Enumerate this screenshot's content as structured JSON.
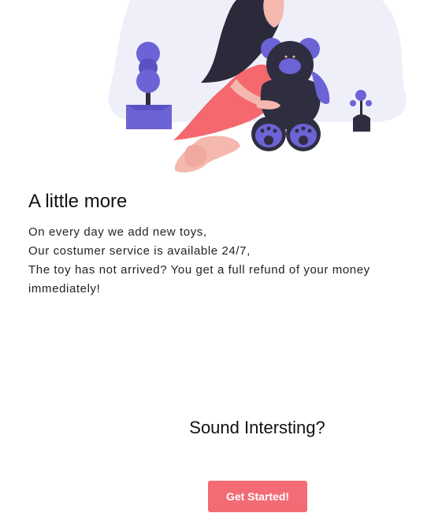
{
  "hero": {
    "image_icon": "girl-with-teddy-bear-illustration",
    "colors": {
      "background_blob": "#efeffa",
      "accent_purple": "#6c63d6",
      "dress": "#f4686e",
      "skin": "#f5b8ae",
      "hair": "#2b2a3a",
      "bear": "#2f2e41"
    }
  },
  "content": {
    "title": "A little more",
    "lines": [
      "On every day we add new toys,",
      "Our costumer service is available 24/7,",
      "The toy has not arrived? You get a full refund of your money immediately!"
    ]
  },
  "cta_section": {
    "prompt": "Sound Intersting?",
    "button_label": "Get Started!",
    "button_color": "#f36b74"
  }
}
